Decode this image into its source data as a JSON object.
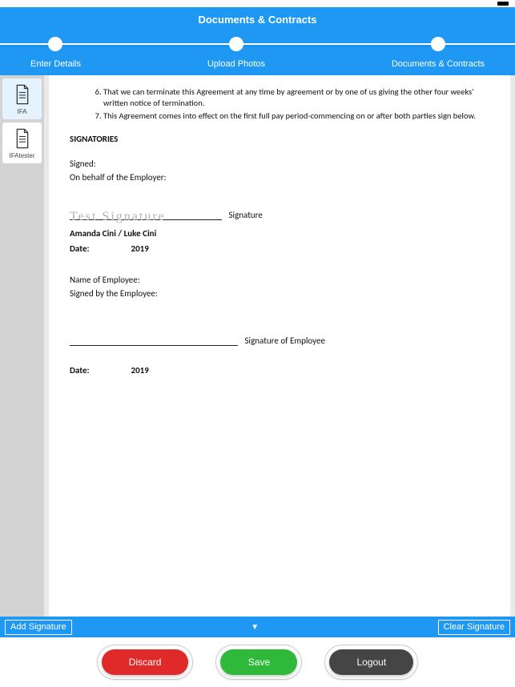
{
  "header": {
    "title": "Documents & Contracts"
  },
  "stepper": {
    "steps": [
      {
        "label": "Enter Details"
      },
      {
        "label": "Upload Photos"
      },
      {
        "label": "Documents & Contracts"
      }
    ]
  },
  "thumbs": [
    {
      "label": "IFA",
      "active": true
    },
    {
      "label": "IFAtester",
      "active": false
    }
  ],
  "document": {
    "clauses": [
      "That we can terminate this Agreement at any time by agreement or by one of us giving the other four weeks' written notice of termination.",
      "This Agreement comes into effect on the first full pay period-commencing on or after both parties sign below."
    ],
    "signatories_heading": "SIGNATORIES",
    "signed_label": "Signed:",
    "on_behalf_label": "On behalf of the Employer:",
    "employer_signature_script": "Test   Signature",
    "signature_word": "Signature",
    "employer_names": "Amanda Cini / Luke Cini",
    "date_label": "Date:",
    "year": "2019",
    "employee_name_label": "Name of Employee:",
    "signed_by_employee_label": "Signed by the Employee:",
    "signature_employee_word": "Signature of Employee"
  },
  "action_strip": {
    "add_signature": "Add Signature",
    "dropdown_glyph": "▼",
    "clear_signature": "Clear Signature"
  },
  "footer": {
    "discard": "Discard",
    "save": "Save",
    "logout": "Logout"
  }
}
